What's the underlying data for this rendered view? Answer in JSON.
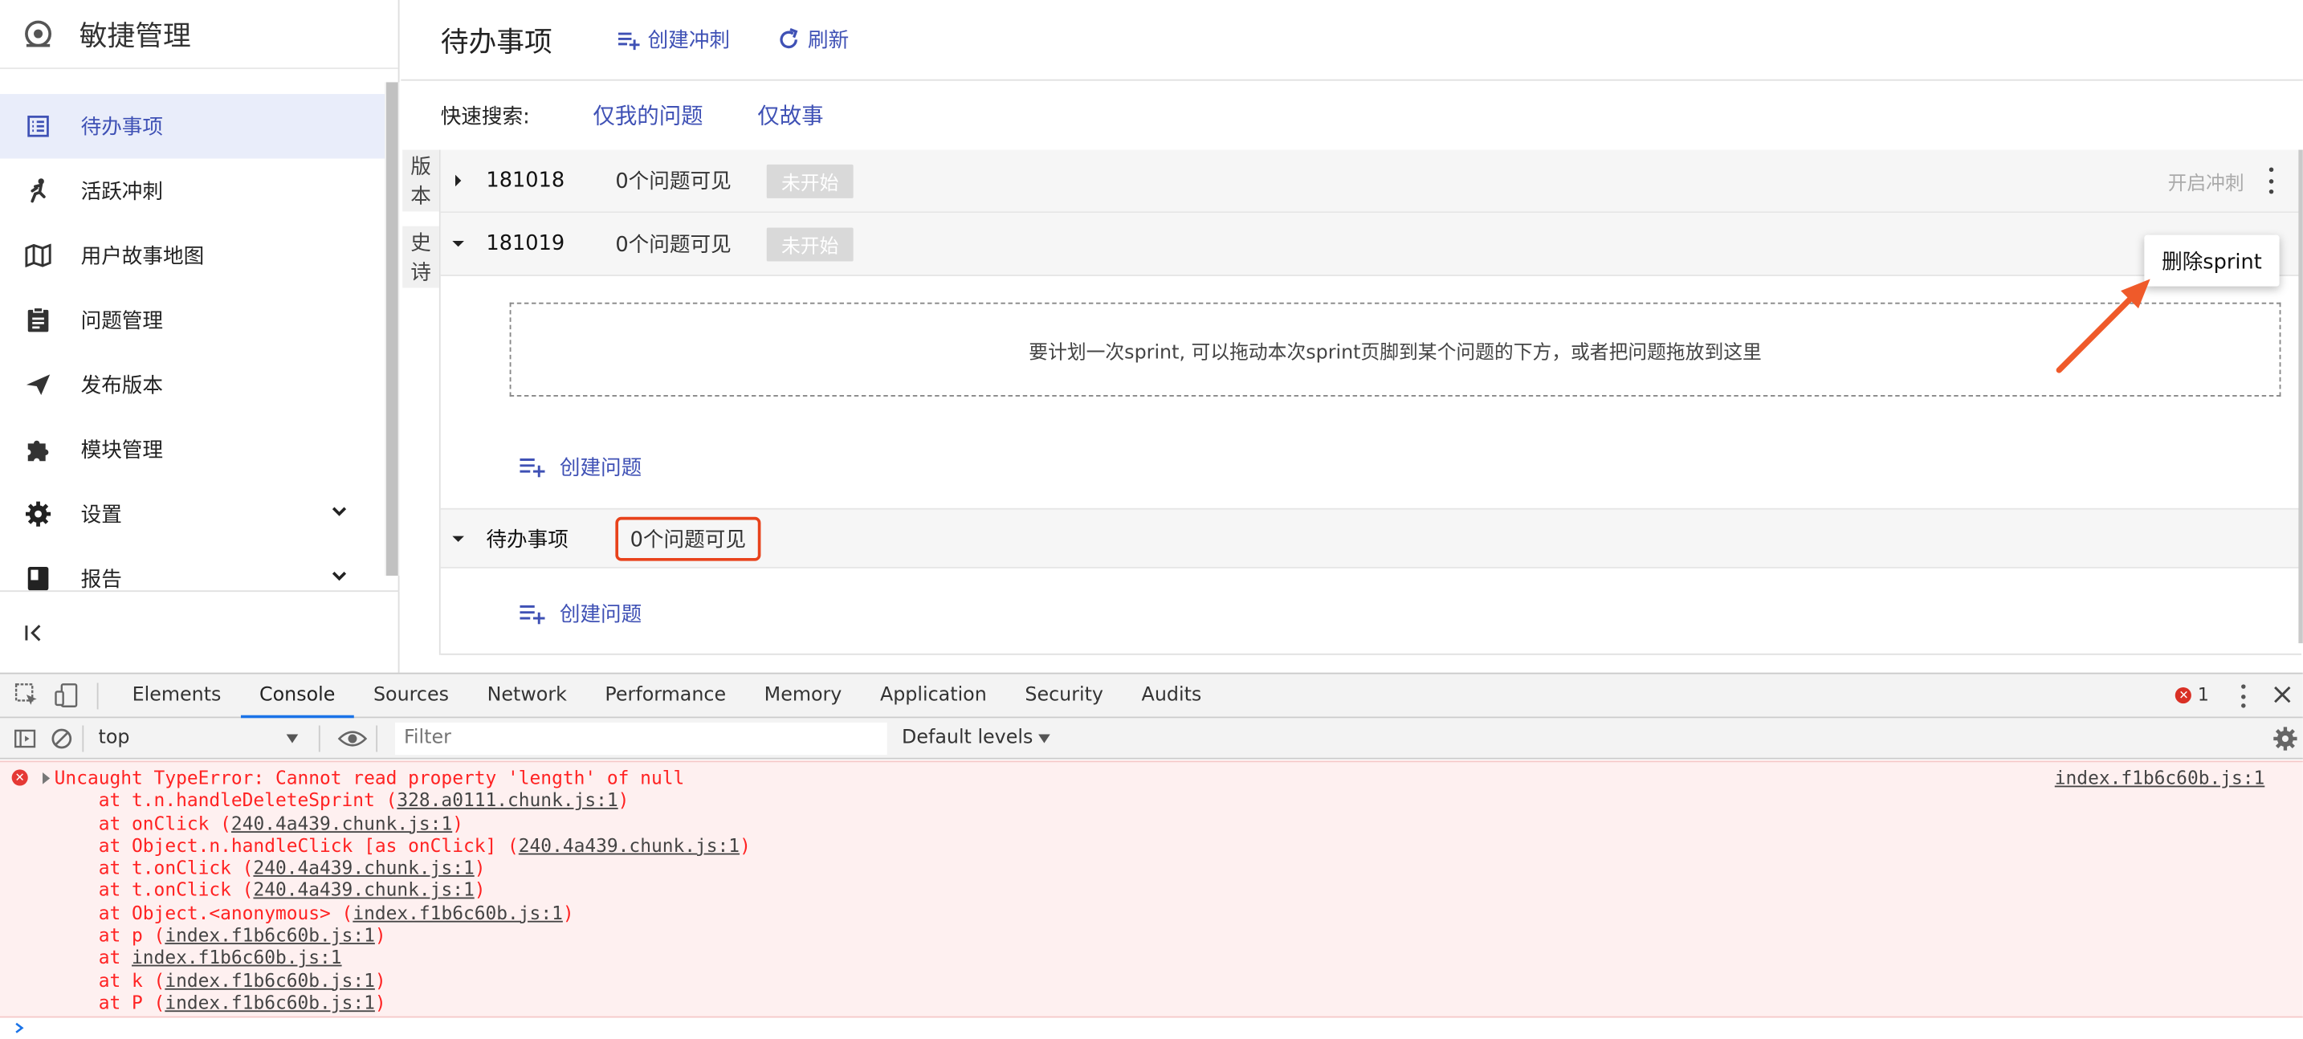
{
  "sidebar": {
    "brand": "敏捷管理",
    "items": [
      {
        "label": "待办事项",
        "icon": "list-icon",
        "active": true
      },
      {
        "label": "活跃冲刺",
        "icon": "run-icon"
      },
      {
        "label": "用户故事地图",
        "icon": "map-icon"
      },
      {
        "label": "问题管理",
        "icon": "clipboard-icon"
      },
      {
        "label": "发布版本",
        "icon": "send-icon"
      },
      {
        "label": "模块管理",
        "icon": "puzzle-icon"
      },
      {
        "label": "设置",
        "icon": "gear-icon"
      },
      {
        "label": "报告",
        "icon": "book-icon"
      }
    ]
  },
  "header": {
    "title": "待办事项",
    "create_sprint": "创建冲刺",
    "refresh": "刷新"
  },
  "quick_search": {
    "label": "快速搜索:",
    "only_mine": "仅我的问题",
    "only_story": "仅故事"
  },
  "side_tabs": {
    "version": "版本",
    "epic": "史诗"
  },
  "sprints": [
    {
      "name": "181018",
      "count": "0个问题可见",
      "status": "未开始",
      "action": "开启冲刺"
    },
    {
      "name": "181019",
      "count": "0个问题可见",
      "status": "未开始"
    }
  ],
  "drop_hint": "要计划一次sprint, 可以拖动本次sprint页脚到某个问题的下方，或者把问题拖放到这里",
  "create_issue": "创建问题",
  "backlog": {
    "name": "待办事项",
    "count": "0个问题可见",
    "create_issue": "创建问题"
  },
  "popup": {
    "delete_sprint": "删除sprint"
  },
  "devtools": {
    "tabs": [
      "Elements",
      "Console",
      "Sources",
      "Network",
      "Performance",
      "Memory",
      "Application",
      "Security",
      "Audits"
    ],
    "active_tab": "Console",
    "error_count": "1",
    "context": "top",
    "filter_placeholder": "Filter",
    "levels": "Default levels",
    "console": {
      "message": "Uncaught TypeError: Cannot read property 'length' of null",
      "source": "index.f1b6c60b.js:1",
      "stack": [
        {
          "pre": "    at t.n.handleDeleteSprint (",
          "src": "328.a0111.chunk.js:1",
          "post": ")"
        },
        {
          "pre": "    at onClick (",
          "src": "240.4a439.chunk.js:1",
          "post": ")"
        },
        {
          "pre": "    at Object.n.handleClick [as onClick] (",
          "src": "240.4a439.chunk.js:1",
          "post": ")"
        },
        {
          "pre": "    at t.onClick (",
          "src": "240.4a439.chunk.js:1",
          "post": ")"
        },
        {
          "pre": "    at t.onClick (",
          "src": "240.4a439.chunk.js:1",
          "post": ")"
        },
        {
          "pre": "    at Object.<anonymous> (",
          "src": "index.f1b6c60b.js:1",
          "post": ")"
        },
        {
          "pre": "    at p (",
          "src": "index.f1b6c60b.js:1",
          "post": ")"
        },
        {
          "pre": "    at ",
          "src": "index.f1b6c60b.js:1",
          "post": ""
        },
        {
          "pre": "    at k (",
          "src": "index.f1b6c60b.js:1",
          "post": ")"
        },
        {
          "pre": "    at P (",
          "src": "index.f1b6c60b.js:1",
          "post": ")"
        }
      ]
    }
  },
  "colors": {
    "accent": "#3f51b5",
    "annotation": "#e8421b",
    "error": "#ff2222"
  }
}
